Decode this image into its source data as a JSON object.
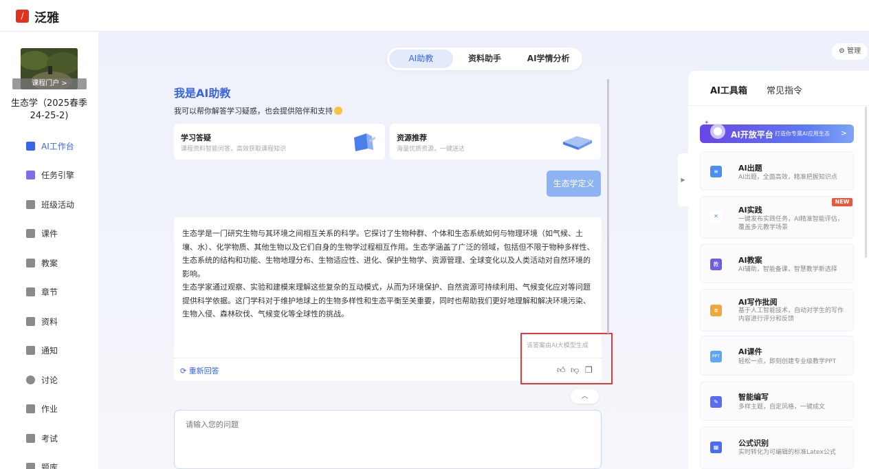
{
  "app": {
    "brand": "泛雅",
    "logo_text": "/"
  },
  "sidebar": {
    "portal_label": "课程门户 >",
    "course_title": "生态学（2025春季 24-25-2)",
    "items": [
      {
        "label": "AI工作台",
        "icon": "ai-icon",
        "color": "#3a64e8"
      },
      {
        "label": "任务引擎",
        "icon": "task-icon",
        "color": "#7b6ff0"
      },
      {
        "label": "班级活动",
        "icon": "grid-icon",
        "color": "#888888"
      },
      {
        "label": "课件",
        "icon": "courseware-icon",
        "color": "#888888"
      },
      {
        "label": "教案",
        "icon": "lesson-plan-icon",
        "color": "#888888"
      },
      {
        "label": "章节",
        "icon": "chapter-icon",
        "color": "#888888"
      },
      {
        "label": "资料",
        "icon": "folder-icon",
        "color": "#888888"
      },
      {
        "label": "通知",
        "icon": "speaker-icon",
        "color": "#888888"
      },
      {
        "label": "讨论",
        "icon": "chat-bubble-icon",
        "color": "#888888"
      },
      {
        "label": "作业",
        "icon": "homework-icon",
        "color": "#888888"
      },
      {
        "label": "考试",
        "icon": "exam-icon",
        "color": "#888888"
      },
      {
        "label": "题库",
        "icon": "question-bank-icon",
        "color": "#888888"
      }
    ]
  },
  "tabs": [
    {
      "label": "AI助教",
      "active": true
    },
    {
      "label": "资料助手",
      "active": false
    },
    {
      "label": "AI学情分析",
      "active": false
    }
  ],
  "chat": {
    "greeting_title": "我是AI助教",
    "greeting_sub": "我可以帮你解答学习疑惑，也会提供陪伴和支持",
    "cards": [
      {
        "title": "学习答疑",
        "desc": "课程资料智能问答，高效获取课程知识"
      },
      {
        "title": "资源推荐",
        "desc": "海量优质资源，一键送达"
      }
    ],
    "user_message": "生态学定义",
    "answer_p1": "生态学是一门研究生物与其环境之间相互关系的科学。它探讨了生物种群、个体和生态系统如何与物理环境（如气候、土壤、水）、化学物质、其他生物以及它们自身的生物学过程相互作用。生态学涵盖了广泛的领域，包括但不限于物种多样性、生态系统的结构和功能、生物地理分布、生物适应性、进化、保护生物学、资源管理、全球变化以及人类活动对自然环境的影响。",
    "answer_p2": "生态学家通过观察、实验和建模来理解这些复杂的互动模式，从而为环境保护、自然资源可持续利用、气候变化应对等问题提供科学依据。这门学科对于维护地球上的生物多样性和生态平衡至关重要，同时也帮助我们更好地理解和解决环境污染、生物入侵、森林砍伐、气候变化等全球性的挑战。",
    "ai_note": "该答案由AI大模型生成",
    "regenerate": "重新回答",
    "input_placeholder": "请输入您的问题"
  },
  "right_panel": {
    "manage": "管理",
    "tabs": [
      {
        "label": "AI工具箱",
        "active": true
      },
      {
        "label": "常见指令",
        "active": false
      }
    ],
    "open_platform": {
      "title": "AI开放平台",
      "sub": "打造你专属AI应用生态",
      "arrow": ">"
    },
    "tools": [
      {
        "title": "AI出题",
        "desc": "AI出题，全面高效，精准把握知识点",
        "color": "#4a8ef0"
      },
      {
        "title": "AI实践",
        "desc": "一键发布实践任务，AI精准智能评估，覆盖多元教学场景",
        "color": "#ffffff",
        "badge": "NEW"
      },
      {
        "title": "AI教案",
        "desc": "AI辅助，智能备课，智慧教学新选择",
        "color": "#6a5fe0"
      },
      {
        "title": "AI写作批阅",
        "desc": "基于人工智能技术，自动对学生的写作内容进行评分和反馈",
        "color": "#f0a83a"
      },
      {
        "title": "AI课件",
        "desc": "轻松一点，即刻创建专业级教学PPT",
        "color": "#5fa6f5"
      },
      {
        "title": "智能编写",
        "desc": "多样主题，自定风格，一键成文",
        "color": "#5b6cf0"
      },
      {
        "title": "公式识别",
        "desc": "实时转化为可编辑的标准Latex公式",
        "color": "#4a6cf0"
      }
    ]
  }
}
